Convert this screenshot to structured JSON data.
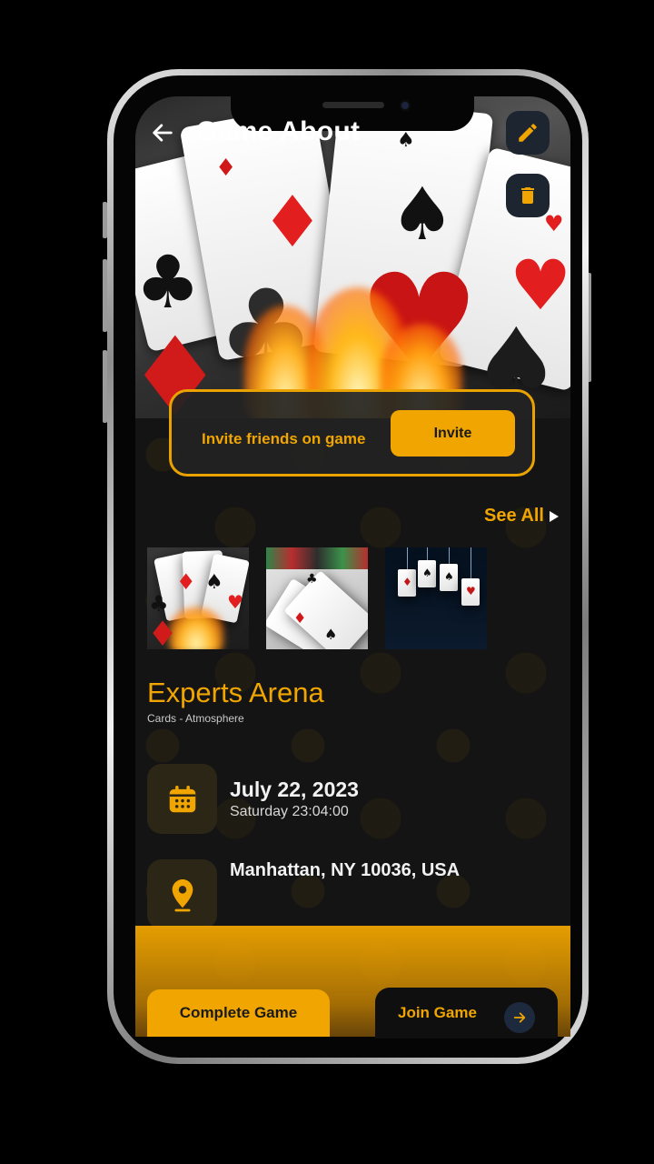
{
  "header": {
    "title": "Game About",
    "back_icon": "arrow-left-icon",
    "edit_icon": "pencil-icon",
    "delete_icon": "trash-icon"
  },
  "invite": {
    "text": "Invite friends on game",
    "button_label": "Invite"
  },
  "gallery": {
    "see_all_label": "See All",
    "items": [
      "cards-fire-thumb",
      "cards-chips-thumb",
      "hanging-cards-thumb"
    ]
  },
  "game": {
    "name": "Experts Arena",
    "category": "Cards - Atmosphere"
  },
  "schedule": {
    "date": "July 22, 2023",
    "time": "Saturday 23:04:00",
    "icon": "calendar-icon"
  },
  "place": {
    "address": "Manhattan, NY 10036, USA",
    "icon": "location-pin-icon"
  },
  "actions": {
    "complete_label": "Complete Game",
    "join_label": "Join Game",
    "join_icon": "arrow-right-icon"
  },
  "colors": {
    "accent": "#f0a500",
    "background": "#141414",
    "icon_button_bg": "#1d2530"
  }
}
